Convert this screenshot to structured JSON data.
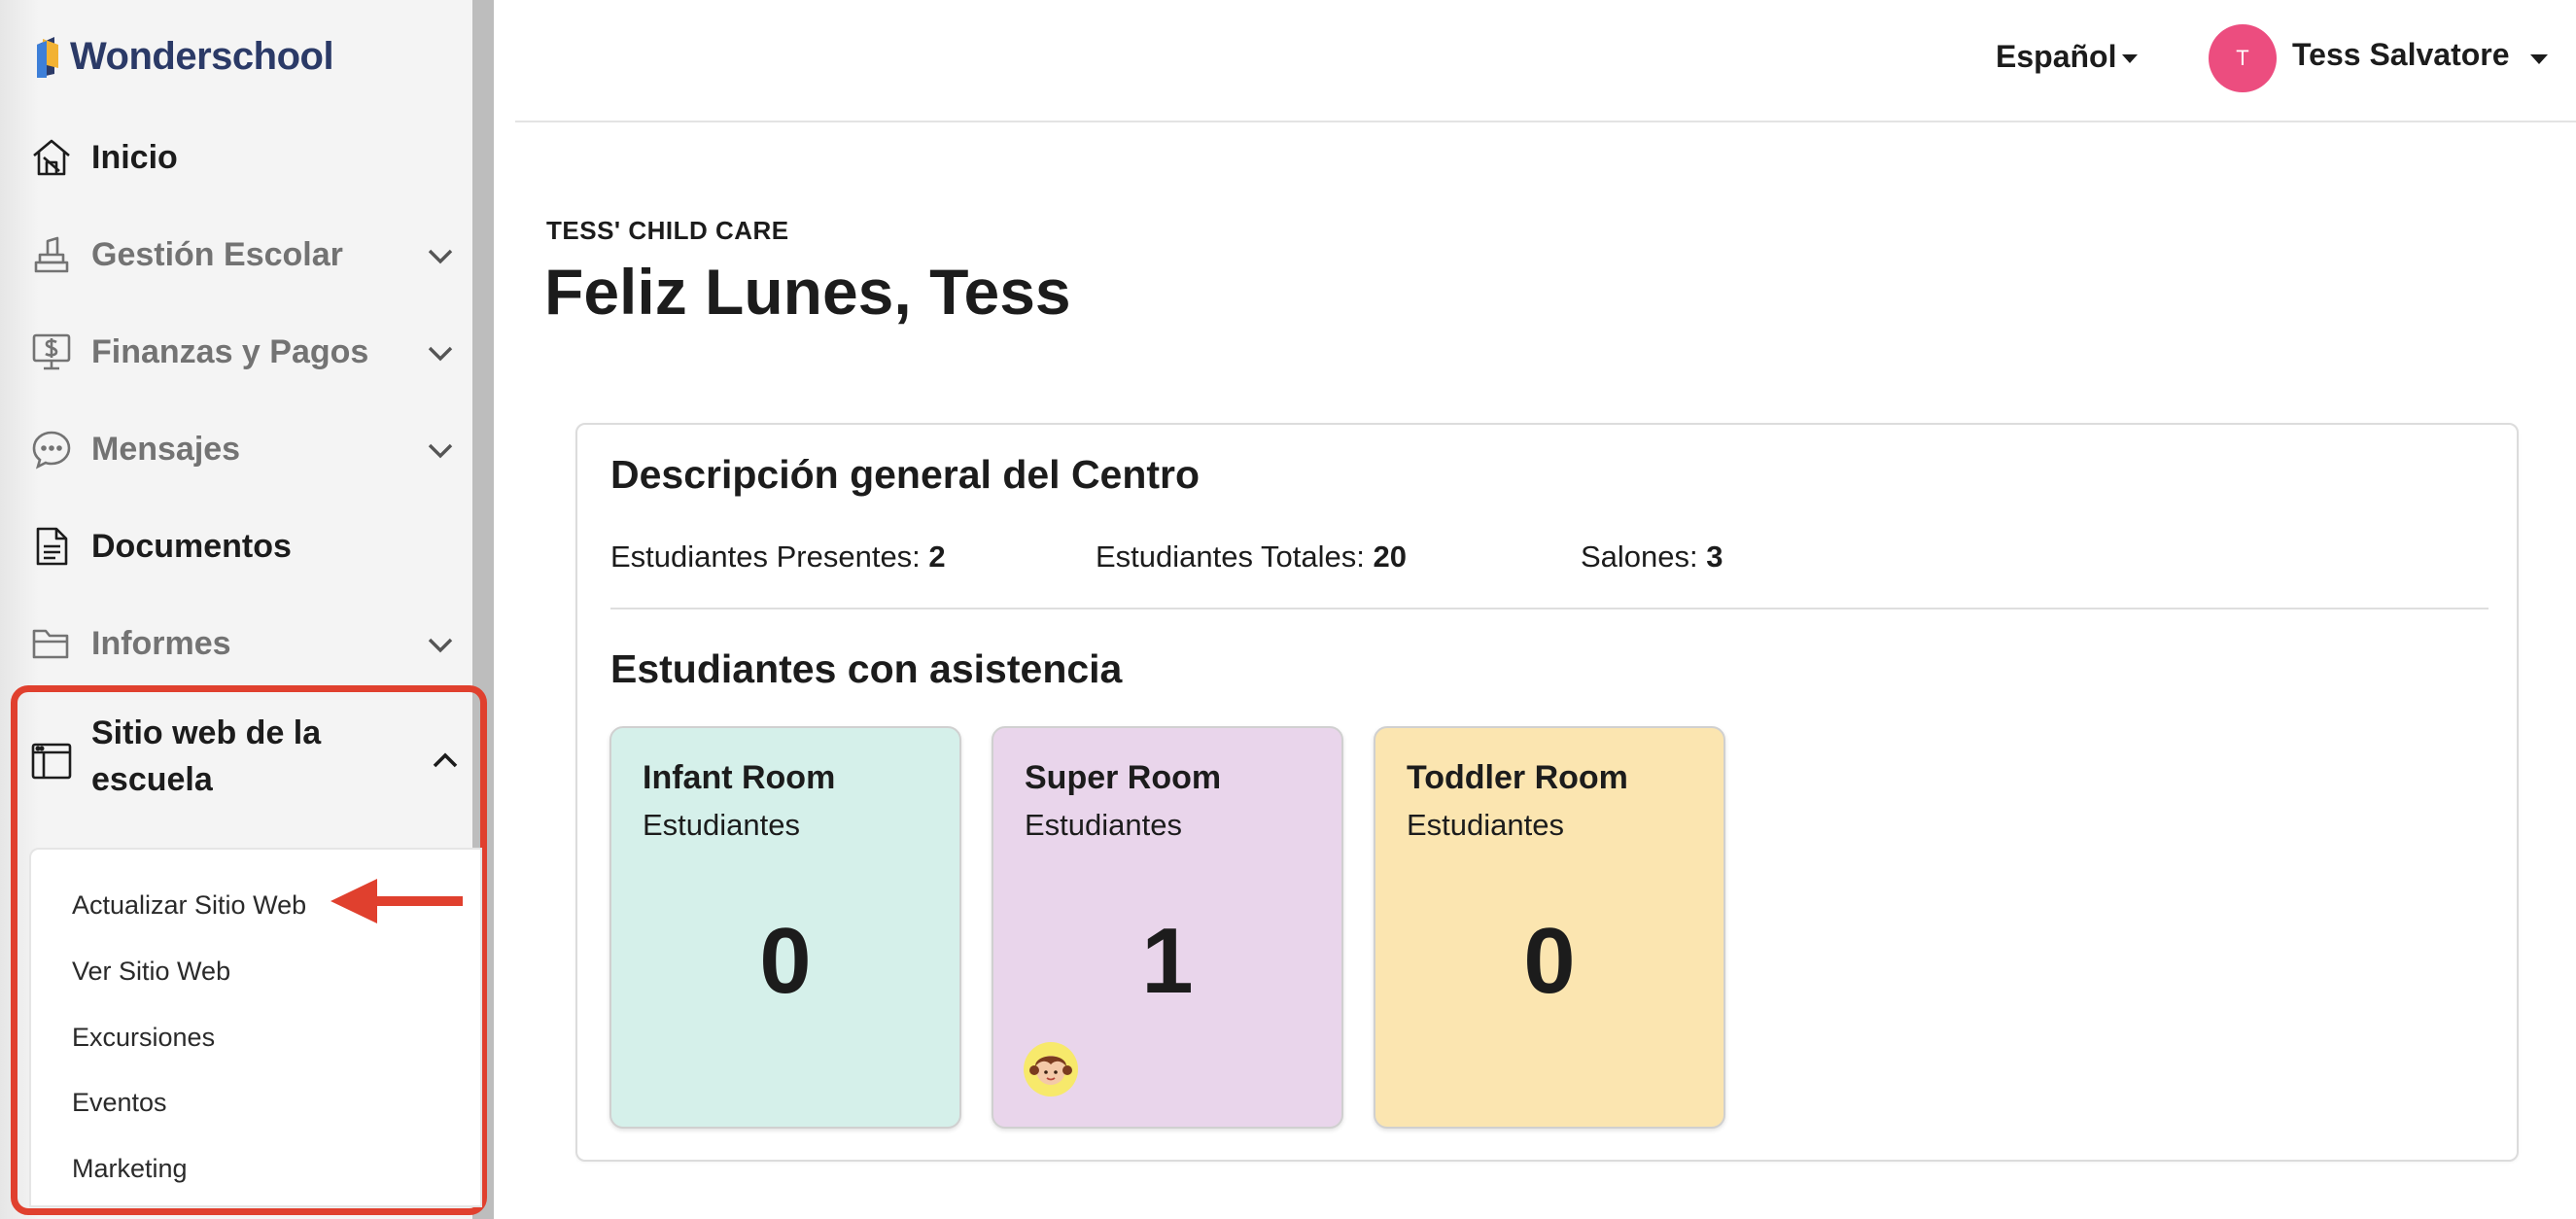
{
  "sidebar": {
    "logo_text": "Wonderschool",
    "items": [
      {
        "label": "Inicio",
        "icon": "home-icon"
      },
      {
        "label": "Gestión Escolar",
        "icon": "school-management-icon"
      },
      {
        "label": "Finanzas y Pagos",
        "icon": "finance-icon"
      },
      {
        "label": "Mensajes",
        "icon": "messages-icon"
      },
      {
        "label": "Documentos",
        "icon": "documents-icon"
      },
      {
        "label": "Informes",
        "icon": "reports-folder-icon"
      }
    ],
    "school_site": {
      "label": "Sitio web de la escuela",
      "icon": "website-icon",
      "submenu": [
        "Actualizar Sitio Web",
        "Ver Sitio Web",
        "Excursiones",
        "Eventos",
        "Marketing"
      ]
    },
    "highlight_color": "#e0402e"
  },
  "header": {
    "language": "Español",
    "user_initial": "T",
    "user_name": "Tess Salvatore",
    "avatar_color": "#ec4d7f"
  },
  "main": {
    "center_name": "TESS' CHILD CARE",
    "greeting": "Feliz Lunes, Tess",
    "overview": {
      "title": "Descripción general del Centro",
      "stats": [
        {
          "label": "Estudiantes Presentes:",
          "value": "2"
        },
        {
          "label": "Estudiantes Totales:",
          "value": "20"
        },
        {
          "label": "Salones:",
          "value": "3"
        }
      ]
    },
    "attendance": {
      "title": "Estudiantes con asistencia",
      "rooms": [
        {
          "name": "Infant Room",
          "sub": "Estudiantes",
          "count": "0",
          "color": "#d5f0ea"
        },
        {
          "name": "Super Room",
          "sub": "Estudiantes",
          "count": "1",
          "color": "#e9d5eb"
        },
        {
          "name": "Toddler Room",
          "sub": "Estudiantes",
          "count": "0",
          "color": "#fbe5b0"
        }
      ]
    }
  }
}
